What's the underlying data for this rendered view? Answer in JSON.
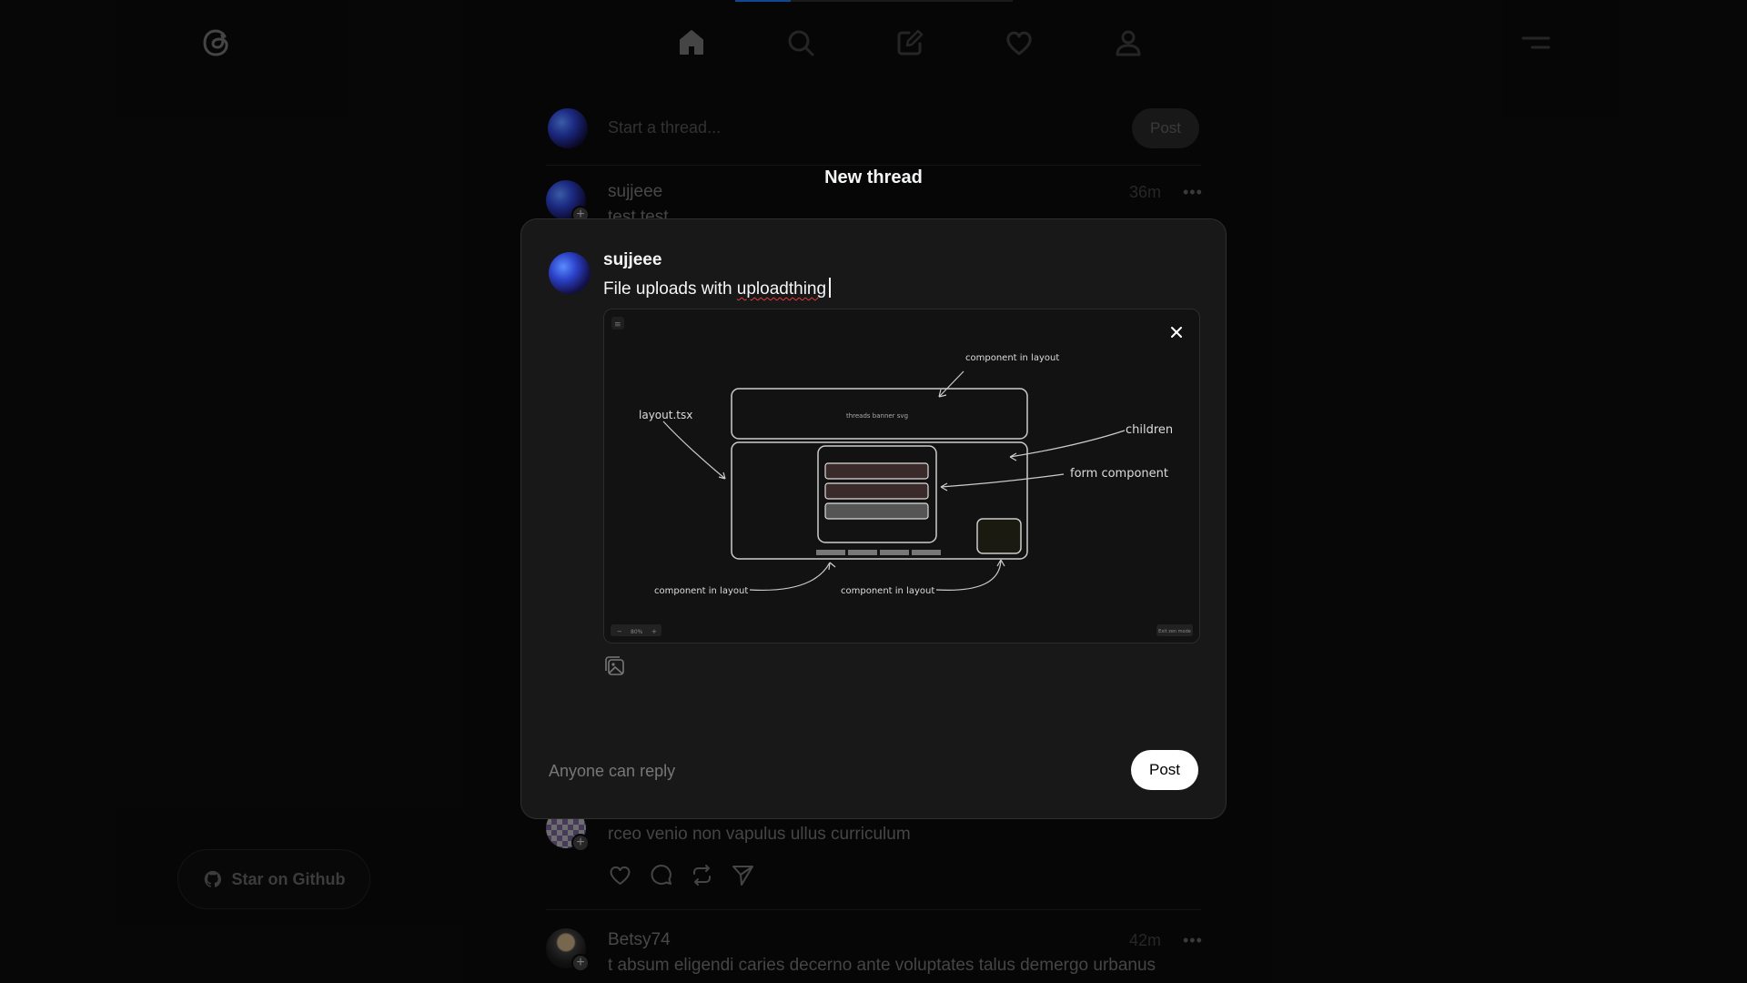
{
  "nav": {
    "items": [
      {
        "name": "home-icon"
      },
      {
        "name": "search-icon"
      },
      {
        "name": "compose-icon"
      },
      {
        "name": "heart-icon"
      },
      {
        "name": "profile-icon"
      }
    ],
    "progress_fraction": 0.2
  },
  "composer": {
    "placeholder": "Start a thread...",
    "post_label": "Post"
  },
  "feed": {
    "posts": [
      {
        "user": "sujjeee",
        "time": "36m",
        "text": "test test"
      },
      {
        "user": "",
        "time": "",
        "text": "rceo venio non vapulus ullus curriculum"
      },
      {
        "user": "Betsy74",
        "time": "42m",
        "text": "t absum eligendi caries decerno ante voluptates talus demergo urbanus"
      }
    ]
  },
  "sidebar": {
    "star_label": "Star on Github"
  },
  "modal": {
    "title": "New thread",
    "user": "sujjeee",
    "text_before": "File uploads with ",
    "text_misspelled": "uploadthing",
    "reply_setting": "Anyone can reply",
    "post_label": "Post",
    "image": {
      "labels": {
        "top": "component in layout",
        "left": "layout.tsx",
        "children": "children",
        "form": "form component",
        "bottom_left": "component in layout",
        "bottom_right": "component in layout",
        "banner": "threads banner svg",
        "zoom": "80%",
        "hint": "Exit zen mode"
      }
    }
  },
  "colors": {
    "background": "#0a0a0a",
    "modal": "#181818",
    "accent": "#1d6fe0"
  }
}
